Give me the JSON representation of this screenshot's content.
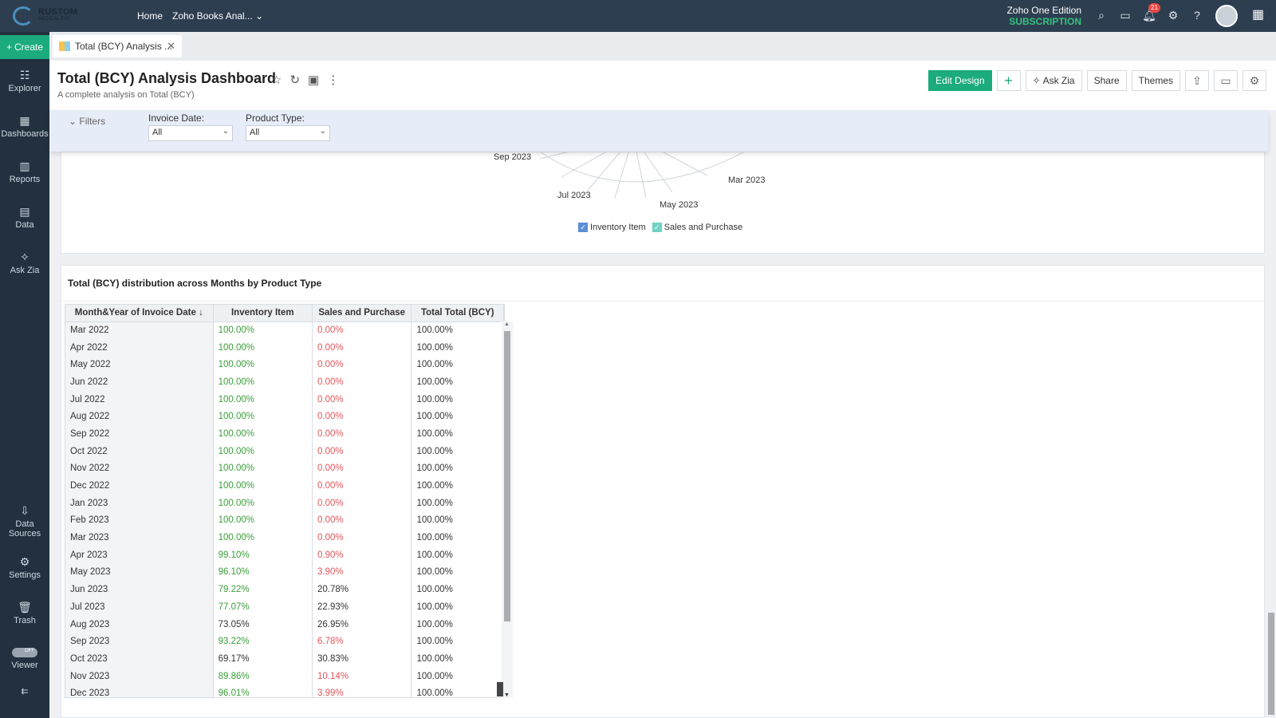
{
  "topbar": {
    "logo_line1": "RUSTOM",
    "logo_line2": "MEDICAL EST",
    "home": "Home",
    "workspace": "Zoho Books Anal...",
    "edition": "Zoho One Edition",
    "subscription": "SUBSCRIPTION",
    "notification_count": "21"
  },
  "sidebar": {
    "create": "Create",
    "explorer": "Explorer",
    "dashboards": "Dashboards",
    "reports": "Reports",
    "data": "Data",
    "askzia": "Ask Zia",
    "datasources_1": "Data",
    "datasources_2": "Sources",
    "settings": "Settings",
    "trash": "Trash",
    "viewer": "Viewer",
    "viewer_toggle": "OFF"
  },
  "tab": {
    "label": "Total (BCY) Analysis ..."
  },
  "header": {
    "title": "Total (BCY) Analysis Dashboard",
    "subtitle": "A complete analysis on Total (BCY)",
    "edit_design": "Edit Design",
    "ask_zia": "Ask Zia",
    "share": "Share",
    "themes": "Themes"
  },
  "filters": {
    "toggle": "Filters",
    "invoice_date_label": "Invoice Date:",
    "invoice_date_value": "All",
    "product_type_label": "Product Type:",
    "product_type_value": "All"
  },
  "chart_panel": {
    "labels": [
      "Sep 2023",
      "Jul 2023",
      "May 2023",
      "Mar 2023"
    ],
    "legend": [
      "Inventory Item",
      "Sales and Purchase"
    ],
    "colors": {
      "inventory": "#5b8fd6",
      "sales": "#6fd3c3"
    }
  },
  "table_panel": {
    "title": "Total (BCY) distribution across Months by Product Type",
    "columns": [
      "Month&Year of Invoice Date",
      "Inventory Item",
      "Sales and Purchase",
      "Total Total (BCY)"
    ],
    "rows": [
      [
        "Mar 2022",
        "100.00%",
        "0.00%",
        "100.00%"
      ],
      [
        "Apr 2022",
        "100.00%",
        "0.00%",
        "100.00%"
      ],
      [
        "May 2022",
        "100.00%",
        "0.00%",
        "100.00%"
      ],
      [
        "Jun 2022",
        "100.00%",
        "0.00%",
        "100.00%"
      ],
      [
        "Jul 2022",
        "100.00%",
        "0.00%",
        "100.00%"
      ],
      [
        "Aug 2022",
        "100.00%",
        "0.00%",
        "100.00%"
      ],
      [
        "Sep 2022",
        "100.00%",
        "0.00%",
        "100.00%"
      ],
      [
        "Oct 2022",
        "100.00%",
        "0.00%",
        "100.00%"
      ],
      [
        "Nov 2022",
        "100.00%",
        "0.00%",
        "100.00%"
      ],
      [
        "Dec 2022",
        "100.00%",
        "0.00%",
        "100.00%"
      ],
      [
        "Jan 2023",
        "100.00%",
        "0.00%",
        "100.00%"
      ],
      [
        "Feb 2023",
        "100.00%",
        "0.00%",
        "100.00%"
      ],
      [
        "Mar 2023",
        "100.00%",
        "0.00%",
        "100.00%"
      ],
      [
        "Apr 2023",
        "99.10%",
        "0.90%",
        "100.00%"
      ],
      [
        "May 2023",
        "96.10%",
        "3.90%",
        "100.00%"
      ],
      [
        "Jun 2023",
        "79.22%",
        "20.78%",
        "100.00%"
      ],
      [
        "Jul 2023",
        "77.07%",
        "22.93%",
        "100.00%"
      ],
      [
        "Aug 2023",
        "73.05%",
        "26.95%",
        "100.00%"
      ],
      [
        "Sep 2023",
        "93.22%",
        "6.78%",
        "100.00%"
      ],
      [
        "Oct 2023",
        "69.17%",
        "30.83%",
        "100.00%"
      ],
      [
        "Nov 2023",
        "89.86%",
        "10.14%",
        "100.00%"
      ],
      [
        "Dec 2023",
        "96.01%",
        "3.99%",
        "100.00%"
      ]
    ],
    "cell_colors": [
      [
        "green",
        "red"
      ],
      [
        "green",
        "red"
      ],
      [
        "green",
        "red"
      ],
      [
        "green",
        "red"
      ],
      [
        "green",
        "red"
      ],
      [
        "green",
        "red"
      ],
      [
        "green",
        "red"
      ],
      [
        "green",
        "red"
      ],
      [
        "green",
        "red"
      ],
      [
        "green",
        "red"
      ],
      [
        "green",
        "red"
      ],
      [
        "green",
        "red"
      ],
      [
        "green",
        "red"
      ],
      [
        "green",
        "red"
      ],
      [
        "green",
        "red"
      ],
      [
        "green",
        "dark"
      ],
      [
        "green",
        "dark"
      ],
      [
        "dark",
        "dark"
      ],
      [
        "green",
        "red"
      ],
      [
        "dark",
        "dark"
      ],
      [
        "green",
        "red"
      ],
      [
        "green",
        "red"
      ]
    ]
  }
}
